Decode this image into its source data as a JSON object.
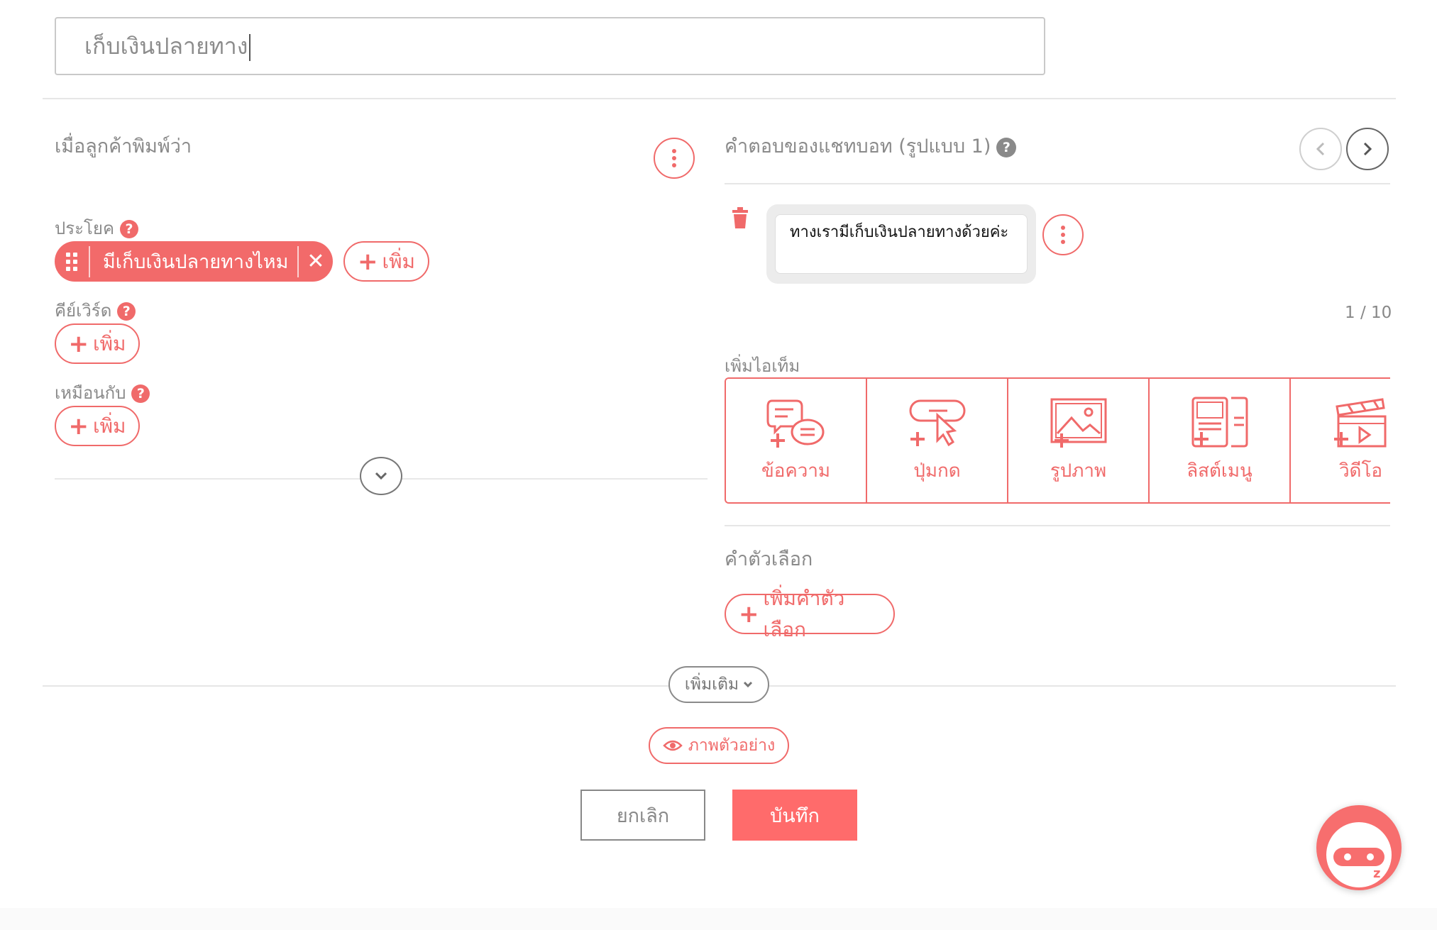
{
  "intent_title": {
    "value": "เก็บเงินปลายทาง"
  },
  "left": {
    "heading": "เมื่อลูกค้าพิมพ์ว่า",
    "sentence_label": "ประโยค",
    "sentence_chip": "มีเก็บเงินปลายทางไหม",
    "keyword_label": "คีย์เวิร์ด",
    "similar_label": "เหมือนกับ",
    "add_label": "เพิ่ม",
    "help_glyph": "?"
  },
  "right": {
    "heading": "คำตอบของแชทบอท (รูปแบบ 1)",
    "reply_text": "ทางเรามีเก็บเงินปลายทางด้วยค่ะ",
    "page_counter": "1 / 10",
    "add_item_label": "เพิ่มไอเท็ม",
    "items": [
      {
        "label": "ข้อความ",
        "icon": "chat-bubbles-icon"
      },
      {
        "label": "ปุ่มกด",
        "icon": "button-cursor-icon"
      },
      {
        "label": "รูปภาพ",
        "icon": "image-icon"
      },
      {
        "label": "ลิสต์เมนู",
        "icon": "list-menu-icon"
      },
      {
        "label": "วิดีโอ",
        "icon": "video-clapper-icon"
      }
    ],
    "quick_reply_label": "คำตัวเลือก",
    "add_quick_reply": "เพิ่มคำตัวเลือก"
  },
  "more_label": "เพิ่มเติม",
  "preview_label": "ภาพตัวอย่าง",
  "cancel_label": "ยกเลิก",
  "save_label": "บันทึก",
  "bot_badge": "z",
  "colors": {
    "accent": "#f06a6a",
    "save_button": "#ff6b6b",
    "muted": "#8a8a8a"
  }
}
